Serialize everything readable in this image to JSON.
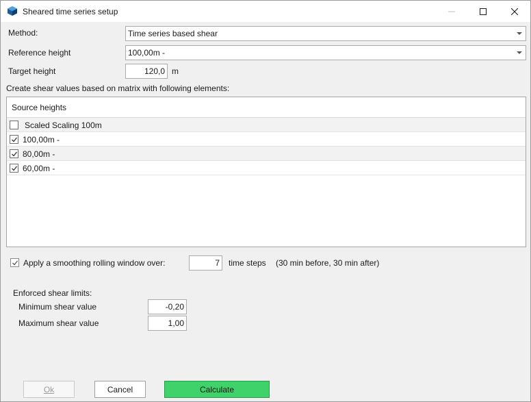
{
  "window": {
    "title": "Sheared time series setup",
    "icon": "app-cube-icon"
  },
  "form": {
    "method_label": "Method:",
    "method_value": "Time series based shear",
    "reference_label": "Reference height",
    "reference_value": "100,00m -",
    "target_label": "Target height",
    "target_value": "120,0",
    "target_unit": "m",
    "matrix_caption": "Create shear values based on matrix with following elements:"
  },
  "source_panel": {
    "header": "Source heights",
    "rows": [
      {
        "label": "Scaled Scaling 100m",
        "checked": false
      },
      {
        "label": "100,00m -",
        "checked": true
      },
      {
        "label": "80,00m -",
        "checked": true
      },
      {
        "label": "60,00m -",
        "checked": true
      }
    ]
  },
  "smoothing": {
    "checked": true,
    "label": "Apply a smoothing rolling window over:",
    "value": "7",
    "unit": "time steps",
    "note": "(30 min before, 30 min after)"
  },
  "limits": {
    "title": "Enforced shear limits:",
    "min_label": "Minimum shear value",
    "min_value": "-0,20",
    "max_label": "Maximum shear value",
    "max_value": "1,00"
  },
  "buttons": {
    "ok": "Ok",
    "cancel": "Cancel",
    "calculate": "Calculate"
  },
  "colors": {
    "calculate_bg": "#3fd26a",
    "checkmark": "#333333"
  }
}
